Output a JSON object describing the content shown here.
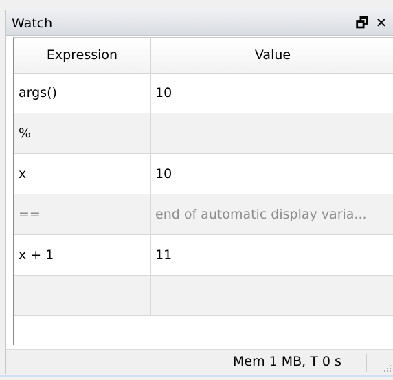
{
  "window": {
    "title": "Watch",
    "float_icon": "window-float-icon",
    "close_icon": "close-icon",
    "float_glyph": "🗗",
    "close_glyph": "✕"
  },
  "table": {
    "columns": [
      "Expression",
      "Value"
    ],
    "rows": [
      {
        "expression": "args()",
        "value": "10",
        "style": "normal"
      },
      {
        "expression": "%",
        "value": "",
        "style": "alt"
      },
      {
        "expression": "x",
        "value": "10",
        "style": "normal"
      },
      {
        "expression": "==",
        "value": "end of automatic display varia...",
        "style": "alt-grey"
      },
      {
        "expression": "x + 1",
        "value": "11",
        "style": "normal"
      },
      {
        "expression": "",
        "value": "",
        "style": "alt"
      }
    ]
  },
  "status": {
    "text": "Mem 1 MB, T 0 s",
    "grip_icon": "resize-grip-icon"
  }
}
